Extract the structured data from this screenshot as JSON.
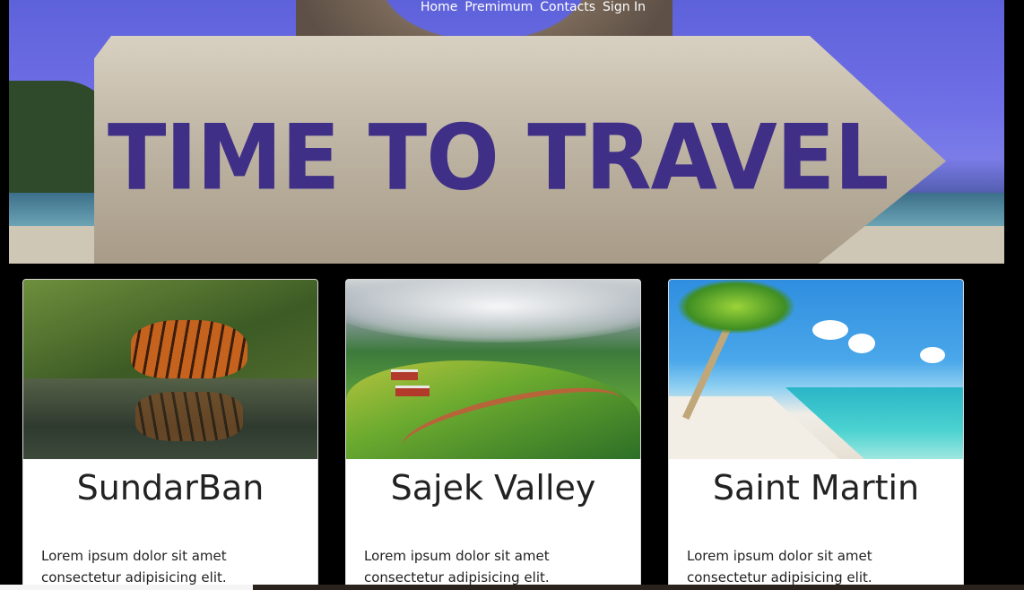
{
  "nav": {
    "items": [
      {
        "label": "Home"
      },
      {
        "label": "Premimum"
      },
      {
        "label": "Contacts"
      },
      {
        "label": "Sign In"
      }
    ]
  },
  "hero": {
    "sign_text": "TIME TO TRAVEL",
    "sign_color": "#3f2f86"
  },
  "cards": [
    {
      "title": "SundarBan",
      "text": "Lorem ipsum dolor sit amet consectetur adipisicing elit. Assumenda voluptatibus"
    },
    {
      "title": "Sajek Valley",
      "text": "Lorem ipsum dolor sit amet consectetur adipisicing elit. Assumenda voluptatibus"
    },
    {
      "title": "Saint Martin",
      "text": "Lorem ipsum dolor sit amet consectetur adipisicing elit. Assumenda voluptatibus"
    }
  ]
}
